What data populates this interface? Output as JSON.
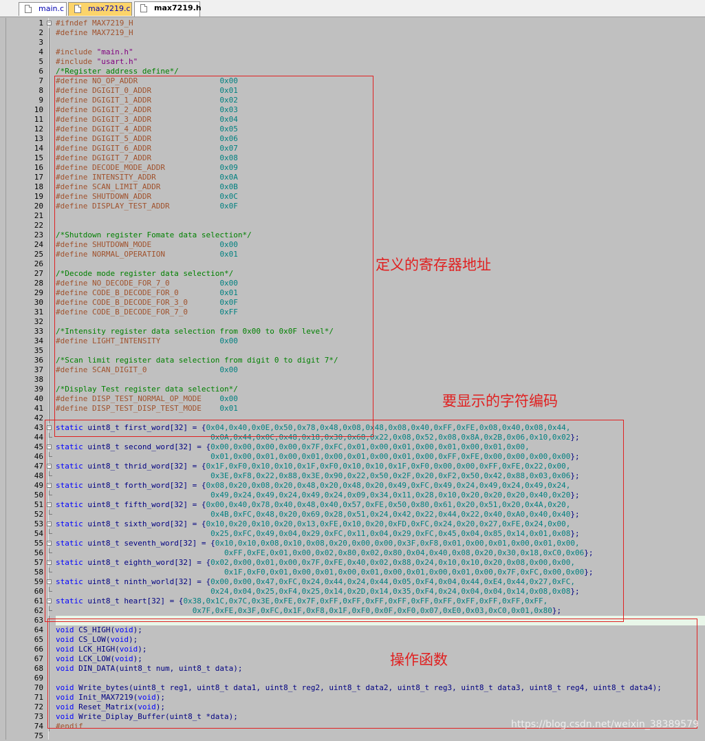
{
  "tabs": [
    {
      "label": "main.c"
    },
    {
      "label": "max7219.c"
    },
    {
      "label": "max7219.h"
    }
  ],
  "annotations": {
    "registers": "定义的寄存器地址",
    "char_codes": "要显示的字符编码",
    "functions": "操作函数"
  },
  "watermark": "https://blog.csdn.net/weixin_38389579",
  "lines": [
    {
      "n": "1",
      "t": [
        [
          "dir",
          "#ifndef MAX7219_H"
        ]
      ]
    },
    {
      "n": "2",
      "t": [
        [
          "dir",
          "#define MAX7219_H"
        ]
      ]
    },
    {
      "n": "3",
      "t": []
    },
    {
      "n": "4",
      "t": [
        [
          "dir",
          "#include "
        ],
        [
          "str",
          "\"main.h\""
        ]
      ]
    },
    {
      "n": "5",
      "t": [
        [
          "dir",
          "#include "
        ],
        [
          "str",
          "\"usart.h\""
        ]
      ]
    },
    {
      "n": "6",
      "t": [
        [
          "cmt",
          "/*Register address define*/"
        ]
      ]
    },
    {
      "n": "7",
      "t": [
        [
          "dir",
          "#define NO_OP_ADDR"
        ],
        [
          "sp",
          "                  "
        ],
        [
          "num",
          "0x00"
        ]
      ]
    },
    {
      "n": "8",
      "t": [
        [
          "dir",
          "#define DGIGIT_0_ADDR"
        ],
        [
          "sp",
          "               "
        ],
        [
          "num",
          "0x01"
        ]
      ]
    },
    {
      "n": "9",
      "t": [
        [
          "dir",
          "#define DGIGIT_1_ADDR"
        ],
        [
          "sp",
          "               "
        ],
        [
          "num",
          "0x02"
        ]
      ]
    },
    {
      "n": "10",
      "t": [
        [
          "dir",
          "#define DGIGIT_2_ADDR"
        ],
        [
          "sp",
          "               "
        ],
        [
          "num",
          "0x03"
        ]
      ]
    },
    {
      "n": "11",
      "t": [
        [
          "dir",
          "#define DGIGIT_3_ADDR"
        ],
        [
          "sp",
          "               "
        ],
        [
          "num",
          "0x04"
        ]
      ]
    },
    {
      "n": "12",
      "t": [
        [
          "dir",
          "#define DGIGIT_4_ADDR"
        ],
        [
          "sp",
          "               "
        ],
        [
          "num",
          "0x05"
        ]
      ]
    },
    {
      "n": "13",
      "t": [
        [
          "dir",
          "#define DGIGIT_5_ADDR"
        ],
        [
          "sp",
          "               "
        ],
        [
          "num",
          "0x06"
        ]
      ]
    },
    {
      "n": "14",
      "t": [
        [
          "dir",
          "#define DGIGIT_6_ADDR"
        ],
        [
          "sp",
          "               "
        ],
        [
          "num",
          "0x07"
        ]
      ]
    },
    {
      "n": "15",
      "t": [
        [
          "dir",
          "#define DGIGIT_7_ADDR"
        ],
        [
          "sp",
          "               "
        ],
        [
          "num",
          "0x08"
        ]
      ]
    },
    {
      "n": "16",
      "t": [
        [
          "dir",
          "#define DECODE_MODE_ADDR"
        ],
        [
          "sp",
          "            "
        ],
        [
          "num",
          "0x09"
        ]
      ]
    },
    {
      "n": "17",
      "t": [
        [
          "dir",
          "#define INTENSITY_ADDR"
        ],
        [
          "sp",
          "              "
        ],
        [
          "num",
          "0x0A"
        ]
      ]
    },
    {
      "n": "18",
      "t": [
        [
          "dir",
          "#define SCAN_LIMIT_ADDR"
        ],
        [
          "sp",
          "             "
        ],
        [
          "num",
          "0x0B"
        ]
      ]
    },
    {
      "n": "19",
      "t": [
        [
          "dir",
          "#define SHUTDOWN_ADDR"
        ],
        [
          "sp",
          "               "
        ],
        [
          "num",
          "0x0C"
        ]
      ]
    },
    {
      "n": "20",
      "t": [
        [
          "dir",
          "#define DISPLAY_TEST_ADDR"
        ],
        [
          "sp",
          "           "
        ],
        [
          "num",
          "0x0F"
        ]
      ]
    },
    {
      "n": "21",
      "t": []
    },
    {
      "n": "22",
      "t": []
    },
    {
      "n": "23",
      "t": [
        [
          "cmt",
          "/*Shutdown register Fomate data selection*/"
        ]
      ]
    },
    {
      "n": "24",
      "t": [
        [
          "dir",
          "#define SHUTDOWN_MODE"
        ],
        [
          "sp",
          "               "
        ],
        [
          "num",
          "0x00"
        ]
      ]
    },
    {
      "n": "25",
      "t": [
        [
          "dir",
          "#define NORMAL_OPERATION"
        ],
        [
          "sp",
          "            "
        ],
        [
          "num",
          "0x01"
        ]
      ]
    },
    {
      "n": "26",
      "t": []
    },
    {
      "n": "27",
      "t": [
        [
          "cmt",
          "/*Decode mode register data selection*/"
        ]
      ]
    },
    {
      "n": "28",
      "t": [
        [
          "dir",
          "#define NO_DECODE_FOR_7_0"
        ],
        [
          "sp",
          "           "
        ],
        [
          "num",
          "0x00"
        ]
      ]
    },
    {
      "n": "29",
      "t": [
        [
          "dir",
          "#define CODE_B_DECODE_FOR_0"
        ],
        [
          "sp",
          "         "
        ],
        [
          "num",
          "0x01"
        ]
      ]
    },
    {
      "n": "30",
      "t": [
        [
          "dir",
          "#define CODE_B_DECODE_FOR_3_0"
        ],
        [
          "sp",
          "       "
        ],
        [
          "num",
          "0x0F"
        ]
      ]
    },
    {
      "n": "31",
      "t": [
        [
          "dir",
          "#define CODE_B_DECODE_FOR_7_0"
        ],
        [
          "sp",
          "       "
        ],
        [
          "num",
          "0xFF"
        ]
      ]
    },
    {
      "n": "32",
      "t": []
    },
    {
      "n": "33",
      "t": [
        [
          "cmt",
          "/*Intensity register data selection from 0x00 to 0x0F level*/"
        ]
      ]
    },
    {
      "n": "34",
      "t": [
        [
          "dir",
          "#define LIGHT_INTENSITY"
        ],
        [
          "sp",
          "             "
        ],
        [
          "num",
          "0x00"
        ]
      ]
    },
    {
      "n": "35",
      "t": []
    },
    {
      "n": "36",
      "t": [
        [
          "cmt",
          "/*Scan limit register data selection from digit 0 to digit 7*/"
        ]
      ]
    },
    {
      "n": "37",
      "t": [
        [
          "dir",
          "#define SCAN_DIGIT_0"
        ],
        [
          "sp",
          "                "
        ],
        [
          "num",
          "0x00"
        ]
      ]
    },
    {
      "n": "38",
      "t": []
    },
    {
      "n": "39",
      "t": [
        [
          "cmt",
          "/*Display Test register data selection*/"
        ]
      ]
    },
    {
      "n": "40",
      "t": [
        [
          "dir",
          "#define DISP_TEST_NORMAL_OP_MODE"
        ],
        [
          "sp",
          "    "
        ],
        [
          "num",
          "0x00"
        ]
      ]
    },
    {
      "n": "41",
      "t": [
        [
          "dir",
          "#define DISP_TEST_DISP_TEST_MODE"
        ],
        [
          "sp",
          "    "
        ],
        [
          "num",
          "0x01"
        ]
      ]
    },
    {
      "n": "42",
      "t": []
    },
    {
      "n": "43",
      "f": "open",
      "t": [
        [
          "kw",
          "static "
        ],
        [
          "txt",
          "uint8_t first_word[32] = {"
        ],
        [
          "num",
          "0x04,0x40,0x0E,0x50,0x78,0x48,0x08,0x48,0x08,0x40,0xFF,0xFE,0x08,0x40,0x08,0x44,"
        ]
      ]
    },
    {
      "n": "44",
      "f": "end",
      "t": [
        [
          "sp",
          "                                  "
        ],
        [
          "num",
          "0x0A,0x44,0x0C,0x48,0x18,0x30,0x68,0x22,0x08,0x52,0x08,0x8A,0x2B,0x06,0x10,0x02"
        ],
        [
          "txt",
          "};"
        ]
      ]
    },
    {
      "n": "45",
      "f": "open",
      "t": [
        [
          "kw",
          "static "
        ],
        [
          "txt",
          "uint8_t second_word[32] = {"
        ],
        [
          "num",
          "0x00,0x00,0x00,0x00,0x7F,0xFC,0x01,0x00,0x01,0x00,0x01,0x00,0x01,0x00,"
        ]
      ]
    },
    {
      "n": "46",
      "f": "end",
      "t": [
        [
          "sp",
          "                                  "
        ],
        [
          "num",
          "0x01,0x00,0x01,0x00,0x01,0x00,0x01,0x00,0x01,0x00,0xFF,0xFE,0x00,0x00,0x00,0x00"
        ],
        [
          "txt",
          "};"
        ]
      ]
    },
    {
      "n": "47",
      "f": "open",
      "t": [
        [
          "kw",
          "static "
        ],
        [
          "txt",
          "uint8_t thrid_word[32] = {"
        ],
        [
          "num",
          "0x1F,0xF0,0x10,0x10,0x1F,0xF0,0x10,0x10,0x1F,0xF0,0x00,0x00,0xFF,0xFE,0x22,0x00,"
        ]
      ]
    },
    {
      "n": "48",
      "f": "end",
      "t": [
        [
          "sp",
          "                                  "
        ],
        [
          "num",
          "0x3E,0xF8,0x22,0x88,0x3E,0x90,0x22,0x50,0x2F,0x20,0xF2,0x50,0x42,0x88,0x03,0x06"
        ],
        [
          "txt",
          "};"
        ]
      ]
    },
    {
      "n": "49",
      "f": "open",
      "t": [
        [
          "kw",
          "static "
        ],
        [
          "txt",
          "uint8_t forth_word[32] = {"
        ],
        [
          "num",
          "0x08,0x20,0x08,0x20,0x48,0x20,0x48,0x20,0x49,0xFC,0x49,0x24,0x49,0x24,0x49,0x24,"
        ]
      ]
    },
    {
      "n": "50",
      "f": "end",
      "t": [
        [
          "sp",
          "                                  "
        ],
        [
          "num",
          "0x49,0x24,0x49,0x24,0x49,0x24,0x09,0x34,0x11,0x28,0x10,0x20,0x20,0x20,0x40,0x20"
        ],
        [
          "txt",
          "};"
        ]
      ]
    },
    {
      "n": "51",
      "f": "open",
      "t": [
        [
          "kw",
          "static "
        ],
        [
          "txt",
          "uint8_t fifth_word[32] = {"
        ],
        [
          "num",
          "0x00,0x40,0x78,0x40,0x48,0x40,0x57,0xFE,0x50,0x80,0x61,0x20,0x51,0x20,0x4A,0x20,"
        ]
      ]
    },
    {
      "n": "52",
      "f": "end",
      "t": [
        [
          "sp",
          "                                  "
        ],
        [
          "num",
          "0x4B,0xFC,0x48,0x20,0x69,0x28,0x51,0x24,0x42,0x22,0x44,0x22,0x40,0xA0,0x40,0x40"
        ],
        [
          "txt",
          "};"
        ]
      ]
    },
    {
      "n": "53",
      "f": "open",
      "t": [
        [
          "kw",
          "static "
        ],
        [
          "txt",
          "uint8_t sixth_word[32] = {"
        ],
        [
          "num",
          "0x10,0x20,0x10,0x20,0x13,0xFE,0x10,0x20,0xFD,0xFC,0x24,0x20,0x27,0xFE,0x24,0x00,"
        ]
      ]
    },
    {
      "n": "54",
      "f": "end",
      "t": [
        [
          "sp",
          "                                  "
        ],
        [
          "num",
          "0x25,0xFC,0x49,0x04,0x29,0xFC,0x11,0x04,0x29,0xFC,0x45,0x04,0x85,0x14,0x01,0x08"
        ],
        [
          "txt",
          "};"
        ]
      ]
    },
    {
      "n": "55",
      "f": "open",
      "t": [
        [
          "kw",
          "static "
        ],
        [
          "txt",
          "uint8_t seventh_word[32] = {"
        ],
        [
          "num",
          "0x10,0x10,0x08,0x10,0x08,0x20,0x00,0x00,0x3F,0xF8,0x01,0x00,0x01,0x00,0x01,0x00,"
        ]
      ]
    },
    {
      "n": "56",
      "f": "end",
      "t": [
        [
          "sp",
          "                                     "
        ],
        [
          "num",
          "0xFF,0xFE,0x01,0x00,0x02,0x80,0x02,0x80,0x04,0x40,0x08,0x20,0x30,0x18,0xC0,0x06"
        ],
        [
          "txt",
          "};"
        ]
      ]
    },
    {
      "n": "57",
      "f": "open",
      "t": [
        [
          "kw",
          "static "
        ],
        [
          "txt",
          "uint8_t eighth_word[32] = {"
        ],
        [
          "num",
          "0x02,0x00,0x01,0x00,0x7F,0xFE,0x40,0x02,0x88,0x24,0x10,0x10,0x20,0x08,0x00,0x00,"
        ]
      ]
    },
    {
      "n": "58",
      "f": "end",
      "t": [
        [
          "sp",
          "                                     "
        ],
        [
          "num",
          "0x1F,0xF0,0x01,0x00,0x01,0x00,0x01,0x00,0x01,0x00,0x01,0x00,0x7F,0xFC,0x00,0x00"
        ],
        [
          "txt",
          "};"
        ]
      ]
    },
    {
      "n": "59",
      "f": "open",
      "t": [
        [
          "kw",
          "static "
        ],
        [
          "txt",
          "uint8_t ninth_world[32] = {"
        ],
        [
          "num",
          "0x00,0x00,0x47,0xFC,0x24,0x44,0x24,0x44,0x05,0xF4,0x04,0x44,0xE4,0x44,0x27,0xFC,"
        ]
      ]
    },
    {
      "n": "60",
      "f": "end",
      "t": [
        [
          "sp",
          "                                  "
        ],
        [
          "num",
          "0x24,0x04,0x25,0xF4,0x25,0x14,0x2D,0x14,0x35,0xF4,0x24,0x04,0x04,0x14,0x08,0x08"
        ],
        [
          "txt",
          "};"
        ]
      ]
    },
    {
      "n": "61",
      "f": "open",
      "t": [
        [
          "kw",
          "static "
        ],
        [
          "txt",
          "uint8_t heart[32] = {"
        ],
        [
          "num",
          "0x38,0x1C,0x7C,0x3E,0xFE,0x7F,0xFF,0xFF,0xFF,0xFF,0xFF,0xFF,0xFF,0xFF,0xFF,0xFF,"
        ]
      ]
    },
    {
      "n": "62",
      "f": "end",
      "t": [
        [
          "sp",
          "                              "
        ],
        [
          "num",
          "0x7F,0xFE,0x3F,0xFC,0x1F,0xF8,0x1F,0xF0,0x0F,0xF0,0x07,0xE0,0x03,0xC0,0x01,0x80"
        ],
        [
          "txt",
          "};"
        ]
      ]
    },
    {
      "n": "63",
      "t": []
    },
    {
      "n": "64",
      "t": [
        [
          "kw",
          "void "
        ],
        [
          "txt",
          "CS_HIGH("
        ],
        [
          "kw",
          "void"
        ],
        [
          "txt",
          ");"
        ]
      ]
    },
    {
      "n": "65",
      "t": [
        [
          "kw",
          "void "
        ],
        [
          "txt",
          "CS_LOW("
        ],
        [
          "kw",
          "void"
        ],
        [
          "txt",
          ");"
        ]
      ]
    },
    {
      "n": "66",
      "t": [
        [
          "kw",
          "void "
        ],
        [
          "txt",
          "LCK_HIGH("
        ],
        [
          "kw",
          "void"
        ],
        [
          "txt",
          ");"
        ]
      ]
    },
    {
      "n": "67",
      "t": [
        [
          "kw",
          "void "
        ],
        [
          "txt",
          "LCK_LOW("
        ],
        [
          "kw",
          "void"
        ],
        [
          "txt",
          ");"
        ]
      ]
    },
    {
      "n": "68",
      "t": [
        [
          "kw",
          "void "
        ],
        [
          "txt",
          "DIN_DATA(uint8_t num, uint8_t data);"
        ]
      ]
    },
    {
      "n": "69",
      "t": []
    },
    {
      "n": "70",
      "t": [
        [
          "kw",
          "void "
        ],
        [
          "txt",
          "Write_bytes(uint8_t reg1, uint8_t data1, uint8_t reg2, uint8_t data2, uint8_t reg3, uint8_t data3, uint8_t reg4, uint8_t data4);"
        ]
      ]
    },
    {
      "n": "71",
      "t": [
        [
          "kw",
          "void "
        ],
        [
          "txt",
          "Init_MAX7219("
        ],
        [
          "kw",
          "void"
        ],
        [
          "txt",
          ");"
        ]
      ]
    },
    {
      "n": "72",
      "t": [
        [
          "kw",
          "void "
        ],
        [
          "txt",
          "Reset_Matrix("
        ],
        [
          "kw",
          "void"
        ],
        [
          "txt",
          ");"
        ]
      ]
    },
    {
      "n": "73",
      "t": [
        [
          "kw",
          "void "
        ],
        [
          "txt",
          "Write_Diplay_Buffer(uint8_t *data);"
        ]
      ]
    },
    {
      "n": "74",
      "t": [
        [
          "dir",
          "#endif"
        ]
      ]
    },
    {
      "n": "75",
      "t": []
    }
  ]
}
